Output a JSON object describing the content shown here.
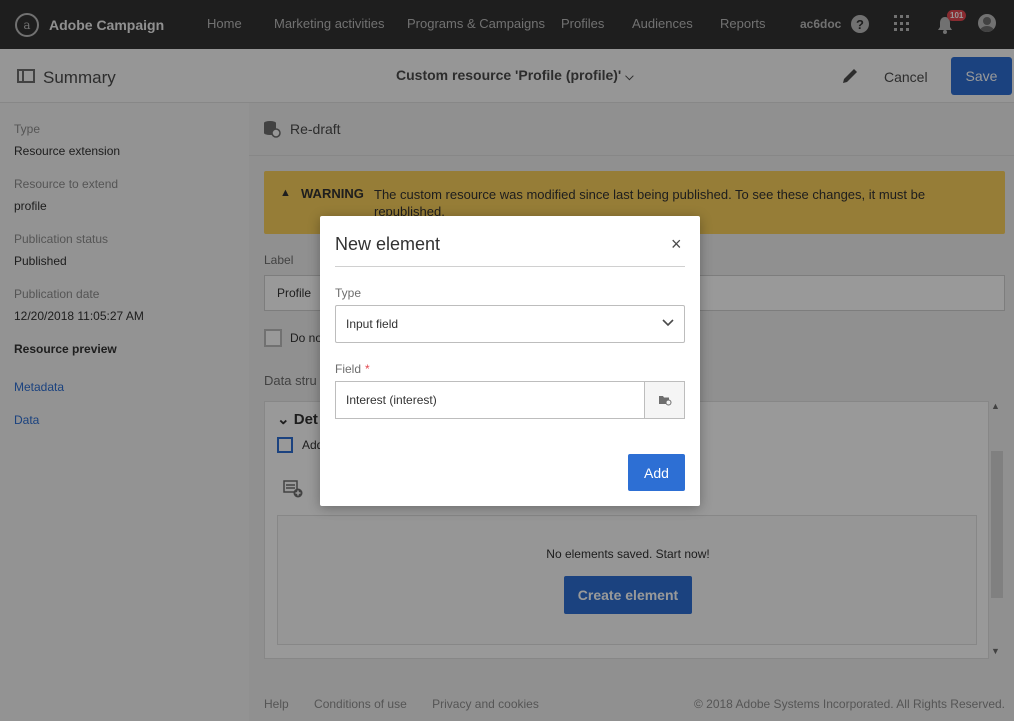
{
  "app": {
    "name": "Adobe Campaign",
    "logo_glyph": "a"
  },
  "nav": {
    "items": [
      "Home",
      "Marketing activities",
      "Programs & Campaigns",
      "Profiles",
      "Audiences",
      "Reports"
    ],
    "user": "ac6doc",
    "help_glyph": "?",
    "notifications_count": "101"
  },
  "header": {
    "summary_title": "Summary",
    "resource_title": "Custom resource 'Profile (profile)'",
    "cancel_label": "Cancel",
    "save_label": "Save"
  },
  "sidebar": {
    "type_label": "Type",
    "type_value": "Resource extension",
    "resource_label": "Resource to extend",
    "resource_value": "profile",
    "status_label": "Publication status",
    "status_value": "Published",
    "date_label": "Publication date",
    "date_value": "12/20/2018 11:05:27 AM",
    "preview_label": "Resource preview",
    "links": [
      "Metadata",
      "Data"
    ]
  },
  "main": {
    "redraft_label": "Re-draft",
    "warning_title": "WARNING",
    "warning_text": "The custom resource was modified since last being published. To see these changes, it must be republished.",
    "label_field_label": "Label",
    "label_value": "Profile",
    "do_not_text": "Do no",
    "data_structure_label": "Data stru",
    "details_title": "Det",
    "details_check_text": "Add",
    "empty_text": "No elements saved. Start now!",
    "create_button": "Create element"
  },
  "footer": {
    "links": [
      "Help",
      "Conditions of use",
      "Privacy and cookies"
    ],
    "copyright": "© 2018 Adobe Systems Incorporated. All Rights Reserved."
  },
  "modal": {
    "title": "New element",
    "close_glyph": "×",
    "type_label": "Type",
    "type_value": "Input field",
    "field_label": "Field",
    "required_marker": "*",
    "field_value": "Interest (interest)",
    "add_label": "Add"
  },
  "colors": {
    "accent": "#2d6fd4",
    "topbar": "#323232",
    "warning": "#fbd05c",
    "badge": "#e34850"
  }
}
